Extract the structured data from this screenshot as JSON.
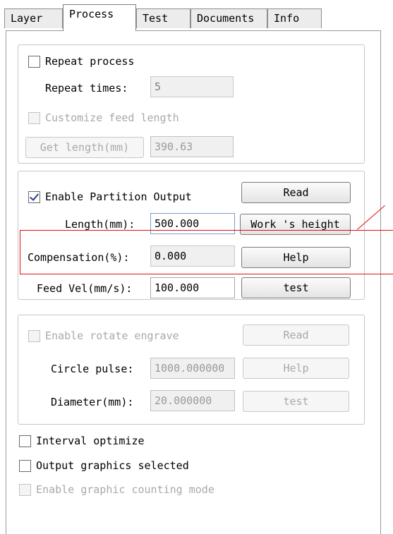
{
  "tabs": [
    {
      "label": "Layer",
      "active": false
    },
    {
      "label": "Process",
      "active": true
    },
    {
      "label": "Test",
      "active": false
    },
    {
      "label": "Documents",
      "active": false
    },
    {
      "label": "Info",
      "active": false
    }
  ],
  "repeat": {
    "checkbox_label": "Repeat process",
    "checked": false,
    "times_label": "Repeat times:",
    "times_value": "5",
    "customize_label": "Customize feed length",
    "get_length_button": "Get length(mm)",
    "length_value": "390.63"
  },
  "partition": {
    "enable_label": "Enable Partition Output",
    "enabled": true,
    "length_label": "Length(mm):",
    "length_value": "500.000",
    "compensation_label": "Compensation(%):",
    "compensation_value": "0.000",
    "feed_vel_label": "Feed Vel(mm/s):",
    "feed_vel_value": "100.000",
    "read_button": "Read",
    "work_height_button": "Work 's height",
    "help_button": "Help",
    "test_button": "test"
  },
  "rotate": {
    "enable_label": "Enable rotate engrave",
    "circle_pulse_label": "Circle pulse:",
    "circle_pulse_value": "1000.000000",
    "diameter_label": "Diameter(mm):",
    "diameter_value": "20.000000",
    "read_button": "Read",
    "help_button": "Help",
    "test_button": "test"
  },
  "options": {
    "interval_label": "Interval optimize",
    "output_selected_label": "Output graphics selected",
    "counting_label": "Enable graphic counting mode"
  },
  "colors": {
    "highlight": "#e01010",
    "check": "#2a3f8f"
  }
}
